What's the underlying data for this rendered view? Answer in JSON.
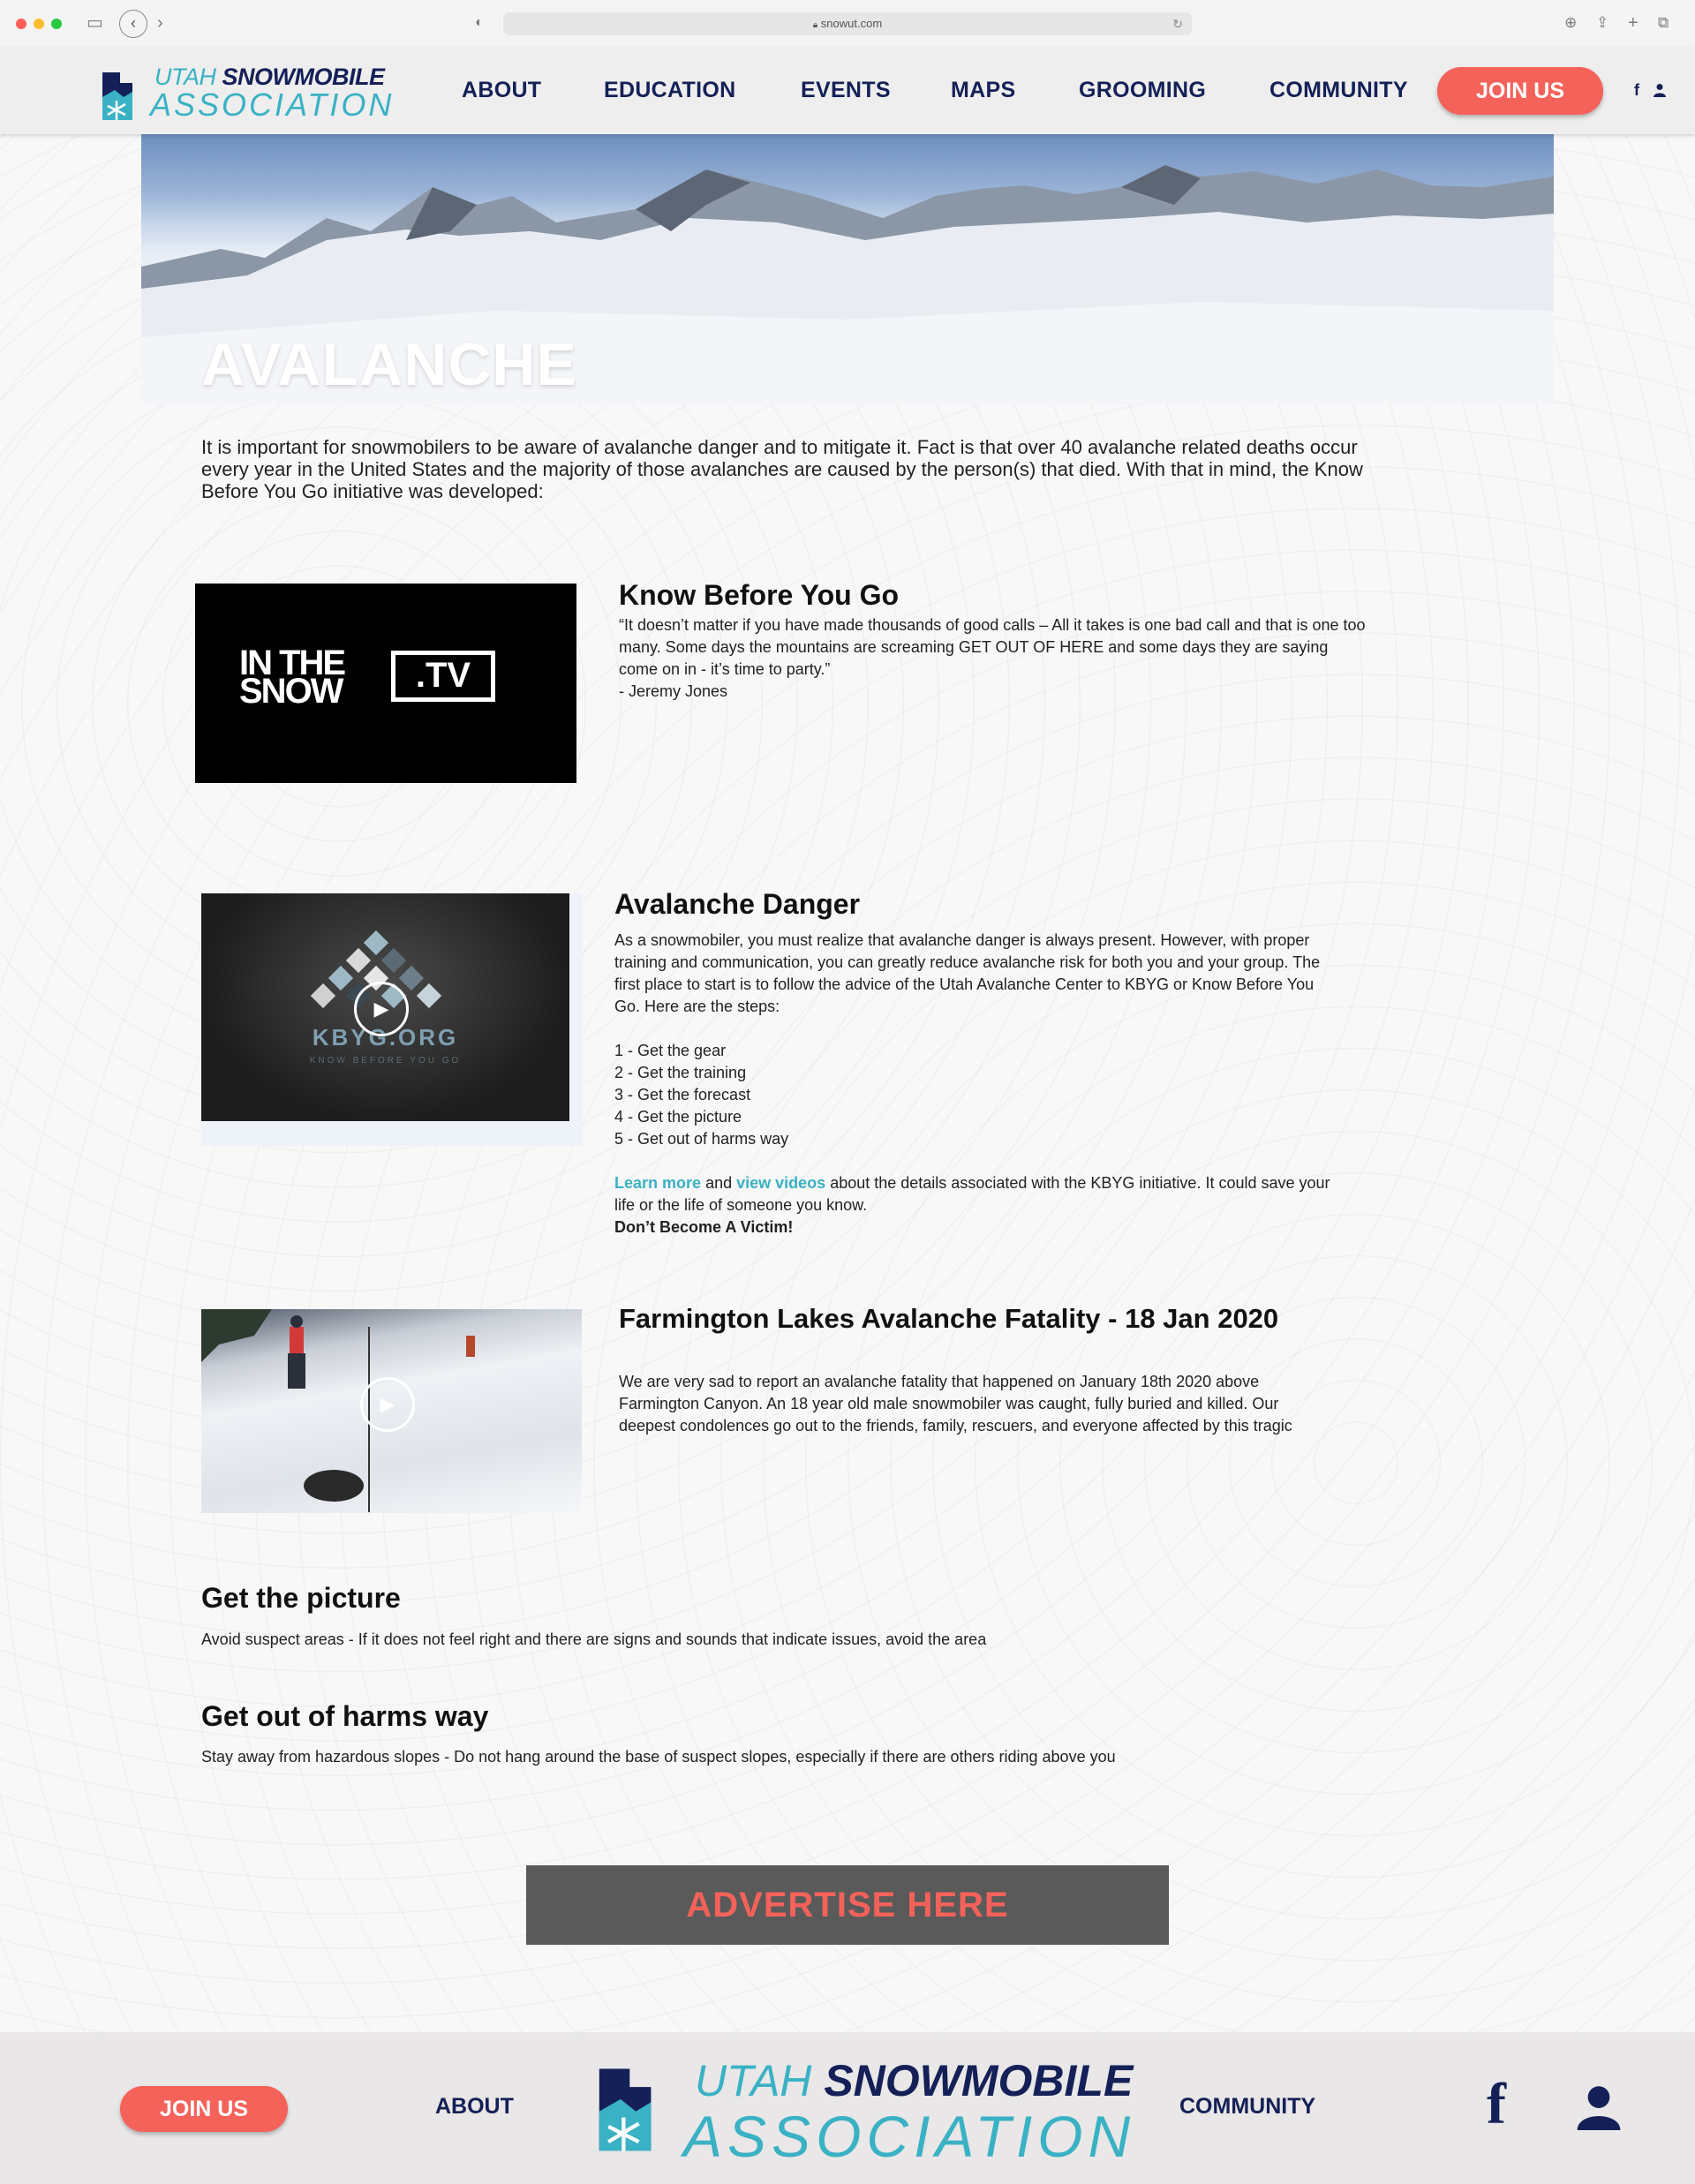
{
  "browser": {
    "url": "snowut.com"
  },
  "header": {
    "logo_top_light": "UTAH",
    "logo_top_bold": "SNOWMOBILE",
    "logo_bottom": "ASSOCIATION",
    "nav": [
      "ABOUT",
      "EDUCATION",
      "EVENTS",
      "MAPS",
      "GROOMING",
      "COMMUNITY"
    ],
    "join_label": "JOIN US",
    "facebook_glyph": "f"
  },
  "hero": {
    "title": "AVALANCHE"
  },
  "intro": "It is important for snowmobilers to be aware of avalanche danger and to mitigate it. Fact is that over 40 avalanche related deaths occur every year in the United States and the majority of those avalanches are caused by the person(s) that died. With that in mind, the Know Before You Go initiative was developed:",
  "kbyg": {
    "thumb_line1": "IN THE",
    "thumb_line2": "SNOW",
    "thumb_tv": ".TV",
    "title": "Know Before You Go",
    "quote": "“It doesn’t matter if you have made thousands of good calls – All it takes is one bad call and that is one too many. Some days the mountains are screaming GET OUT OF HERE and some days they are saying come on in - it’s time to party.”",
    "author": "- Jeremy Jones"
  },
  "danger": {
    "thumb_text": "KBYG.ORG",
    "thumb_sub": "KNOW BEFORE YOU GO",
    "title": "Avalanche Danger",
    "body": "As a snowmobiler, you must realize that avalanche danger is always present. However, with proper training and communication, you can greatly reduce avalanche risk for both you and your group. The first place to start is to follow the advice of the Utah Avalanche Center to KBYG or Know Before You Go. Here are the steps:",
    "steps": [
      "1 - Get the gear",
      "2 - Get the training",
      "3 - Get the forecast",
      "4 - Get the picture",
      "5 - Get out of harms way"
    ],
    "learn_more": "Learn more",
    "and": "and",
    "view_videos": "view videos",
    "tail": "about the details associated with the KBYG initiative. It could save your life or the life of someone you know.",
    "warning": "Don’t Become A Victim!"
  },
  "fatality": {
    "title": "Farmington Lakes Avalanche Fatality - 18 Jan 2020",
    "body": "We are very sad to report an avalanche fatality that happened on January 18th 2020 above Farmington Canyon.  An 18 year old male snowmobiler was caught, fully buried and killed. Our deepest condolences go out to the friends, family, rescuers, and everyone affected by this tragic"
  },
  "picture": {
    "title": "Get the picture",
    "body": "Avoid suspect areas - If it does not feel right and there are signs and sounds that indicate issues, avoid the area"
  },
  "harms": {
    "title": "Get out of harms way",
    "body": "Stay away from hazardous slopes - Do not hang around the base of suspect slopes, especially if there are others riding above you"
  },
  "ad": {
    "label": "ADVERTISE HERE"
  },
  "footer": {
    "join_label": "JOIN US",
    "about": "ABOUT",
    "community": "COMMUNITY",
    "logo_top_light": "UTAH",
    "logo_top_bold": "SNOWMOBILE",
    "logo_bottom": "ASSOCIATION",
    "facebook_glyph": "f"
  },
  "colors": {
    "navy": "#142057",
    "teal": "#3ab1c4",
    "coral": "#f5625a"
  },
  "icons": [
    "sidebar-icon",
    "back-icon",
    "forward-icon",
    "shield-icon",
    "lock-icon",
    "reload-icon",
    "download-icon",
    "share-icon",
    "new-tab-icon",
    "tabs-icon",
    "facebook-icon",
    "user-icon",
    "play-icon"
  ]
}
